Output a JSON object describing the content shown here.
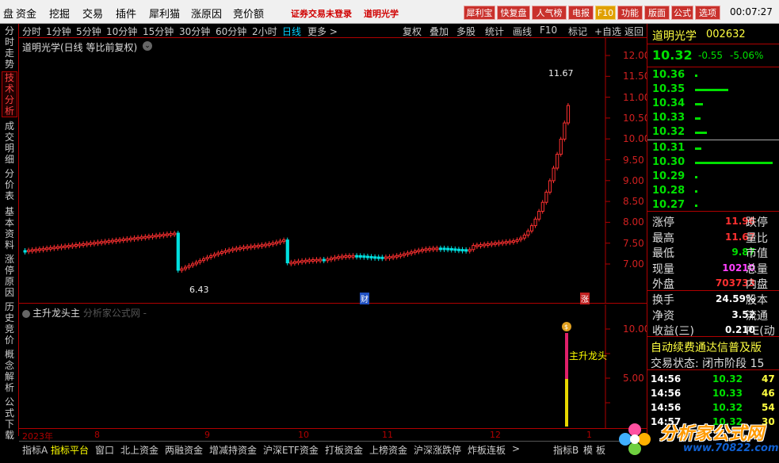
{
  "menu": {
    "items": [
      "盘",
      "资金",
      "挖掘",
      "交易",
      "插件",
      "犀利猫",
      "涨原因",
      "竞价额"
    ],
    "login_status": "证券交易未登录",
    "stock_link": "道明光学",
    "buttons": [
      "犀利宝",
      "快复盘",
      "人气榜",
      "电报",
      "F10",
      "功能",
      "版面",
      "公式",
      "选项"
    ],
    "clock": "00:07:27"
  },
  "left_tabs": [
    "分时走势",
    "技术分析",
    "成交明细",
    "分价表",
    "基本资料",
    "涨停原因",
    "历史竞价",
    "概念解析",
    "公式下载"
  ],
  "left_tab_active": "技术分析",
  "period_bar": {
    "periods": [
      "分时",
      "1分钟",
      "5分钟",
      "10分钟",
      "15分钟",
      "30分钟",
      "60分钟",
      "2小时",
      "日线",
      "更多 >"
    ],
    "active": "日线",
    "tools": [
      "复权",
      "叠加",
      "多股",
      "统计",
      "画线",
      "F10",
      "标记",
      "+自选",
      "返回"
    ]
  },
  "main_chart": {
    "title": "道明光学(日线 等比前复权)",
    "high_label": "11.67",
    "low_label": "6.43",
    "marker_cai": "财",
    "marker_zhang": "涨",
    "y_ticks": [
      "12.00",
      "11.50",
      "11.00",
      "10.50",
      "10.00",
      "9.50",
      "9.00",
      "8.50",
      "8.00",
      "7.50",
      "7.00"
    ]
  },
  "sub_chart": {
    "title": "主升龙头主",
    "source": "分析家公式网 -",
    "signal_label": "主升龙头",
    "y_ticks": [
      "10.00",
      "5.00"
    ]
  },
  "date_axis": [
    "2023年",
    "8",
    "9",
    "10",
    "11",
    "12",
    "1"
  ],
  "bottom_tabs": [
    "指标A",
    "指标平台",
    "窗口",
    "北上资金",
    "两融资金",
    "增减持资金",
    "沪深ETF资金",
    "打板资金",
    "上榜资金",
    "沪深涨跌停",
    "炸板连板",
    ">",
    "指标B",
    "模",
    "板"
  ],
  "bottom_tab_active": "指标平台",
  "right_panel": {
    "name": "道明光学",
    "code": "002632",
    "price": "10.32",
    "change": "-0.55",
    "change_pct": "-5.06%",
    "asks": [
      {
        "price": "10.36",
        "bar": 0.03
      },
      {
        "price": "10.35",
        "bar": 0.42
      },
      {
        "price": "10.34",
        "bar": 0.1
      },
      {
        "price": "10.33",
        "bar": 0.07
      },
      {
        "price": "10.32",
        "bar": 0.15
      }
    ],
    "bids": [
      {
        "price": "10.31",
        "bar": 0.08
      },
      {
        "price": "10.30",
        "bar": 0.98
      },
      {
        "price": "10.29",
        "bar": 0.03
      },
      {
        "price": "10.28",
        "bar": 0.03
      },
      {
        "price": "10.27",
        "bar": 0.03
      }
    ],
    "stats": [
      {
        "label": "涨停",
        "value": "11.96",
        "color": "#ff3030",
        "label2": "跌停"
      },
      {
        "label": "最高",
        "value": "11.67",
        "color": "#ff3030",
        "label2": "量比"
      },
      {
        "label": "最低",
        "value": "9.87",
        "color": "#00e000",
        "label2": "市值"
      },
      {
        "label": "现量",
        "value": "10210",
        "color": "#ff40ff",
        "label2": "总量"
      },
      {
        "label": "外盘",
        "value": "703733",
        "color": "#ff3030",
        "label2": "内盘"
      }
    ],
    "stats2": [
      {
        "label": "换手",
        "value": "24.59%",
        "color": "#ffffff",
        "label2": "股本"
      },
      {
        "label": "净资",
        "value": "3.52",
        "color": "#ffffff",
        "label2": "流通"
      },
      {
        "label": "收益(三)",
        "value": "0.210",
        "color": "#ffffff",
        "label2": "PE(动"
      }
    ],
    "ticker": "自动续费通达信普及版",
    "trade_status": "交易状态: 闭市阶段 15",
    "ticks": [
      {
        "time": "14:56",
        "price": "10.32",
        "vol": "47"
      },
      {
        "time": "14:56",
        "price": "10.33",
        "vol": "46"
      },
      {
        "time": "14:56",
        "price": "10.32",
        "vol": "54"
      },
      {
        "time": "14:57",
        "price": "10.32",
        "vol": "30"
      }
    ]
  },
  "watermark": {
    "text": "分析家公式网",
    "url": "www.70822.com"
  },
  "colors": {
    "up": "#ff3030",
    "down": "#00e0e0",
    "grid": "#b00000",
    "signal": "#ffff00"
  }
}
